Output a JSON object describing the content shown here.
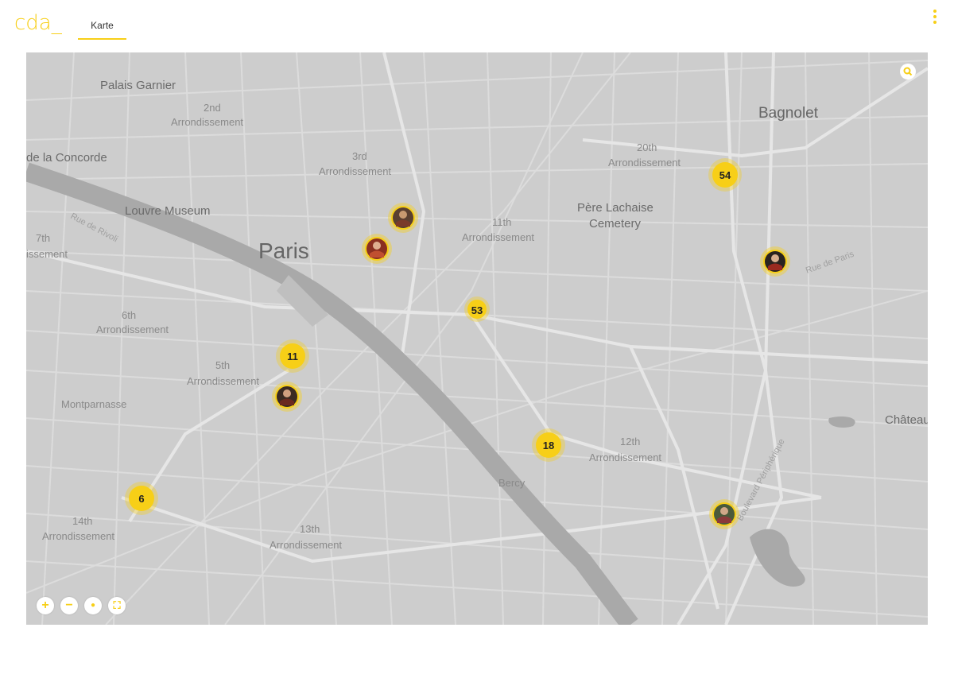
{
  "app": {
    "logo": "cda_",
    "tab_label": "Karte"
  },
  "map": {
    "labels": [
      {
        "text": "Palais Garnier",
        "kind": "place"
      },
      {
        "text": "2nd",
        "kind": "district"
      },
      {
        "text": "Arrondissement",
        "kind": "district"
      },
      {
        "text": "de la Concorde",
        "kind": "place"
      },
      {
        "text": "3rd",
        "kind": "district"
      },
      {
        "text": "Arrondissement",
        "kind": "district"
      },
      {
        "text": "Louvre Museum",
        "kind": "place"
      },
      {
        "text": "Paris",
        "kind": "city"
      },
      {
        "text": "7th",
        "kind": "district"
      },
      {
        "text": "issement",
        "kind": "district"
      },
      {
        "text": "6th",
        "kind": "district"
      },
      {
        "text": "Arrondissement",
        "kind": "district"
      },
      {
        "text": "5th",
        "kind": "district"
      },
      {
        "text": "Arrondissement",
        "kind": "district"
      },
      {
        "text": "Montparnasse",
        "kind": "district"
      },
      {
        "text": "14th",
        "kind": "district"
      },
      {
        "text": "Arrondissement",
        "kind": "district"
      },
      {
        "text": "13th",
        "kind": "district"
      },
      {
        "text": "Arrondissement",
        "kind": "district"
      },
      {
        "text": "11th",
        "kind": "district"
      },
      {
        "text": "Arrondissement",
        "kind": "district"
      },
      {
        "text": "Père Lachaise",
        "kind": "place"
      },
      {
        "text": "Cemetery",
        "kind": "place"
      },
      {
        "text": "20th",
        "kind": "district"
      },
      {
        "text": "Arrondissement",
        "kind": "district"
      },
      {
        "text": "Bagnolet",
        "kind": "city"
      },
      {
        "text": "12th",
        "kind": "district"
      },
      {
        "text": "Arrondissement",
        "kind": "district"
      },
      {
        "text": "Bercy",
        "kind": "district"
      },
      {
        "text": "Château",
        "kind": "city"
      },
      {
        "text": "Rue de Rivoli",
        "kind": "street"
      },
      {
        "text": "Rue de Paris",
        "kind": "street"
      },
      {
        "text": "Boulevard Périphérique",
        "kind": "street"
      }
    ],
    "clusters": [
      {
        "count": "54"
      },
      {
        "count": "53"
      },
      {
        "count": "11"
      },
      {
        "count": "18"
      },
      {
        "count": "6"
      }
    ],
    "photo_markers": [
      {
        "name": "portrait-marker"
      },
      {
        "name": "portrait-marker"
      },
      {
        "name": "portrait-marker"
      },
      {
        "name": "portrait-marker"
      },
      {
        "name": "portrait-marker"
      }
    ],
    "controls": {
      "zoom_in": "+",
      "zoom_out": "−",
      "locate": "●",
      "fullscreen": "⛶"
    },
    "colors": {
      "accent": "#f7cf17",
      "land": "#cdcdcd",
      "roads": "#e0e0e0",
      "river": "#a9a9a9",
      "label": "#6b6b6b"
    }
  }
}
